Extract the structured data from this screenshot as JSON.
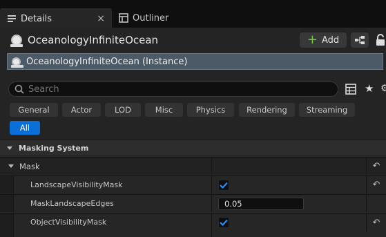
{
  "tabs": {
    "details_label": "Details",
    "close_glyph": "×",
    "outliner_label": "Outliner"
  },
  "header": {
    "actor_name": "OceanologyInfiniteOcean",
    "add_label": "Add",
    "instance_label": "OceanologyInfiniteOcean (Instance)"
  },
  "search": {
    "placeholder": "Search"
  },
  "filters": {
    "general": "General",
    "actor": "Actor",
    "lod": "LOD",
    "misc": "Misc",
    "physics": "Physics",
    "rendering": "Rendering",
    "streaming": "Streaming",
    "all": "All"
  },
  "section": {
    "title": "Masking System"
  },
  "category": {
    "label": "Mask"
  },
  "properties": {
    "landscape_visibility_mask": {
      "label": "LandscapeVisibilityMask",
      "checked": true
    },
    "mask_landscape_edges": {
      "label": "MaskLandscapeEdges",
      "value": "0.05"
    },
    "object_visibility_mask": {
      "label": "ObjectVisibilityMask",
      "checked": true
    }
  },
  "colors": {
    "accent_blue": "#0a70d8",
    "add_green": "#6fcf3a",
    "instance_highlight": "#4b5a66",
    "panel_bg": "#242424"
  },
  "icons": {
    "details_tab": "details-icon",
    "outliner_tab": "outliner-icon",
    "actor": "actor-icon",
    "add": "plus-icon",
    "blueprint": "blueprint-icon",
    "lock": "lock-icon",
    "search": "search-icon",
    "grid": "grid-icon",
    "favorite": "star-icon",
    "settings": "gear-icon",
    "reset": "reset-icon"
  }
}
